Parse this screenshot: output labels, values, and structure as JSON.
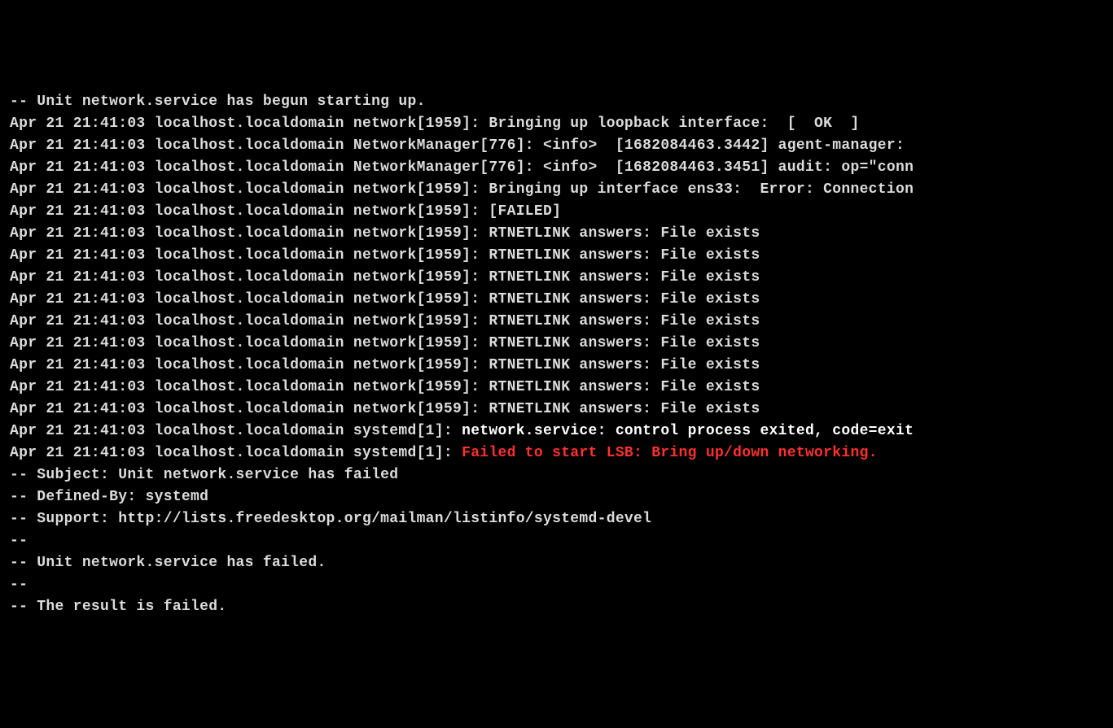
{
  "lines": [
    {
      "segments": [
        {
          "text": "-- Unit network.service has begun starting up.",
          "cls": "normal"
        }
      ]
    },
    {
      "segments": [
        {
          "text": "Apr 21 21:41:03 localhost.localdomain network[1959]: Bringing up loopback interface:  [  OK  ]",
          "cls": "normal"
        }
      ]
    },
    {
      "segments": [
        {
          "text": "Apr 21 21:41:03 localhost.localdomain NetworkManager[776]: <info>  [1682084463.3442] agent-manager:",
          "cls": "normal"
        }
      ]
    },
    {
      "segments": [
        {
          "text": "Apr 21 21:41:03 localhost.localdomain NetworkManager[776]: <info>  [1682084463.3451] audit: op=\"conn",
          "cls": "normal"
        }
      ]
    },
    {
      "segments": [
        {
          "text": "Apr 21 21:41:03 localhost.localdomain network[1959]: Bringing up interface ens33:  Error: Connection",
          "cls": "normal"
        }
      ]
    },
    {
      "segments": [
        {
          "text": "Apr 21 21:41:03 localhost.localdomain network[1959]: [FAILED]",
          "cls": "normal"
        }
      ]
    },
    {
      "segments": [
        {
          "text": "Apr 21 21:41:03 localhost.localdomain network[1959]: RTNETLINK answers: File exists",
          "cls": "normal"
        }
      ]
    },
    {
      "segments": [
        {
          "text": "Apr 21 21:41:03 localhost.localdomain network[1959]: RTNETLINK answers: File exists",
          "cls": "normal"
        }
      ]
    },
    {
      "segments": [
        {
          "text": "Apr 21 21:41:03 localhost.localdomain network[1959]: RTNETLINK answers: File exists",
          "cls": "normal"
        }
      ]
    },
    {
      "segments": [
        {
          "text": "Apr 21 21:41:03 localhost.localdomain network[1959]: RTNETLINK answers: File exists",
          "cls": "normal"
        }
      ]
    },
    {
      "segments": [
        {
          "text": "Apr 21 21:41:03 localhost.localdomain network[1959]: RTNETLINK answers: File exists",
          "cls": "normal"
        }
      ]
    },
    {
      "segments": [
        {
          "text": "Apr 21 21:41:03 localhost.localdomain network[1959]: RTNETLINK answers: File exists",
          "cls": "normal"
        }
      ]
    },
    {
      "segments": [
        {
          "text": "Apr 21 21:41:03 localhost.localdomain network[1959]: RTNETLINK answers: File exists",
          "cls": "normal"
        }
      ]
    },
    {
      "segments": [
        {
          "text": "Apr 21 21:41:03 localhost.localdomain network[1959]: RTNETLINK answers: File exists",
          "cls": "normal"
        }
      ]
    },
    {
      "segments": [
        {
          "text": "Apr 21 21:41:03 localhost.localdomain network[1959]: RTNETLINK answers: File exists",
          "cls": "normal"
        }
      ]
    },
    {
      "segments": [
        {
          "text": "Apr 21 21:41:03 localhost.localdomain systemd[1]: ",
          "cls": "normal"
        },
        {
          "text": "network.service: control process exited, code=exit",
          "cls": "bold"
        }
      ]
    },
    {
      "segments": [
        {
          "text": "Apr 21 21:41:03 localhost.localdomain systemd[1]: ",
          "cls": "normal"
        },
        {
          "text": "Failed to start LSB: Bring up/down networking.",
          "cls": "red"
        }
      ]
    },
    {
      "segments": [
        {
          "text": "-- Subject: Unit network.service has failed",
          "cls": "normal"
        }
      ]
    },
    {
      "segments": [
        {
          "text": "-- Defined-By: systemd",
          "cls": "normal"
        }
      ]
    },
    {
      "segments": [
        {
          "text": "-- Support: http://lists.freedesktop.org/mailman/listinfo/systemd-devel",
          "cls": "normal"
        }
      ]
    },
    {
      "segments": [
        {
          "text": "--",
          "cls": "normal"
        }
      ]
    },
    {
      "segments": [
        {
          "text": "-- Unit network.service has failed.",
          "cls": "normal"
        }
      ]
    },
    {
      "segments": [
        {
          "text": "--",
          "cls": "normal"
        }
      ]
    },
    {
      "segments": [
        {
          "text": "-- The result is failed.",
          "cls": "normal"
        }
      ]
    }
  ]
}
